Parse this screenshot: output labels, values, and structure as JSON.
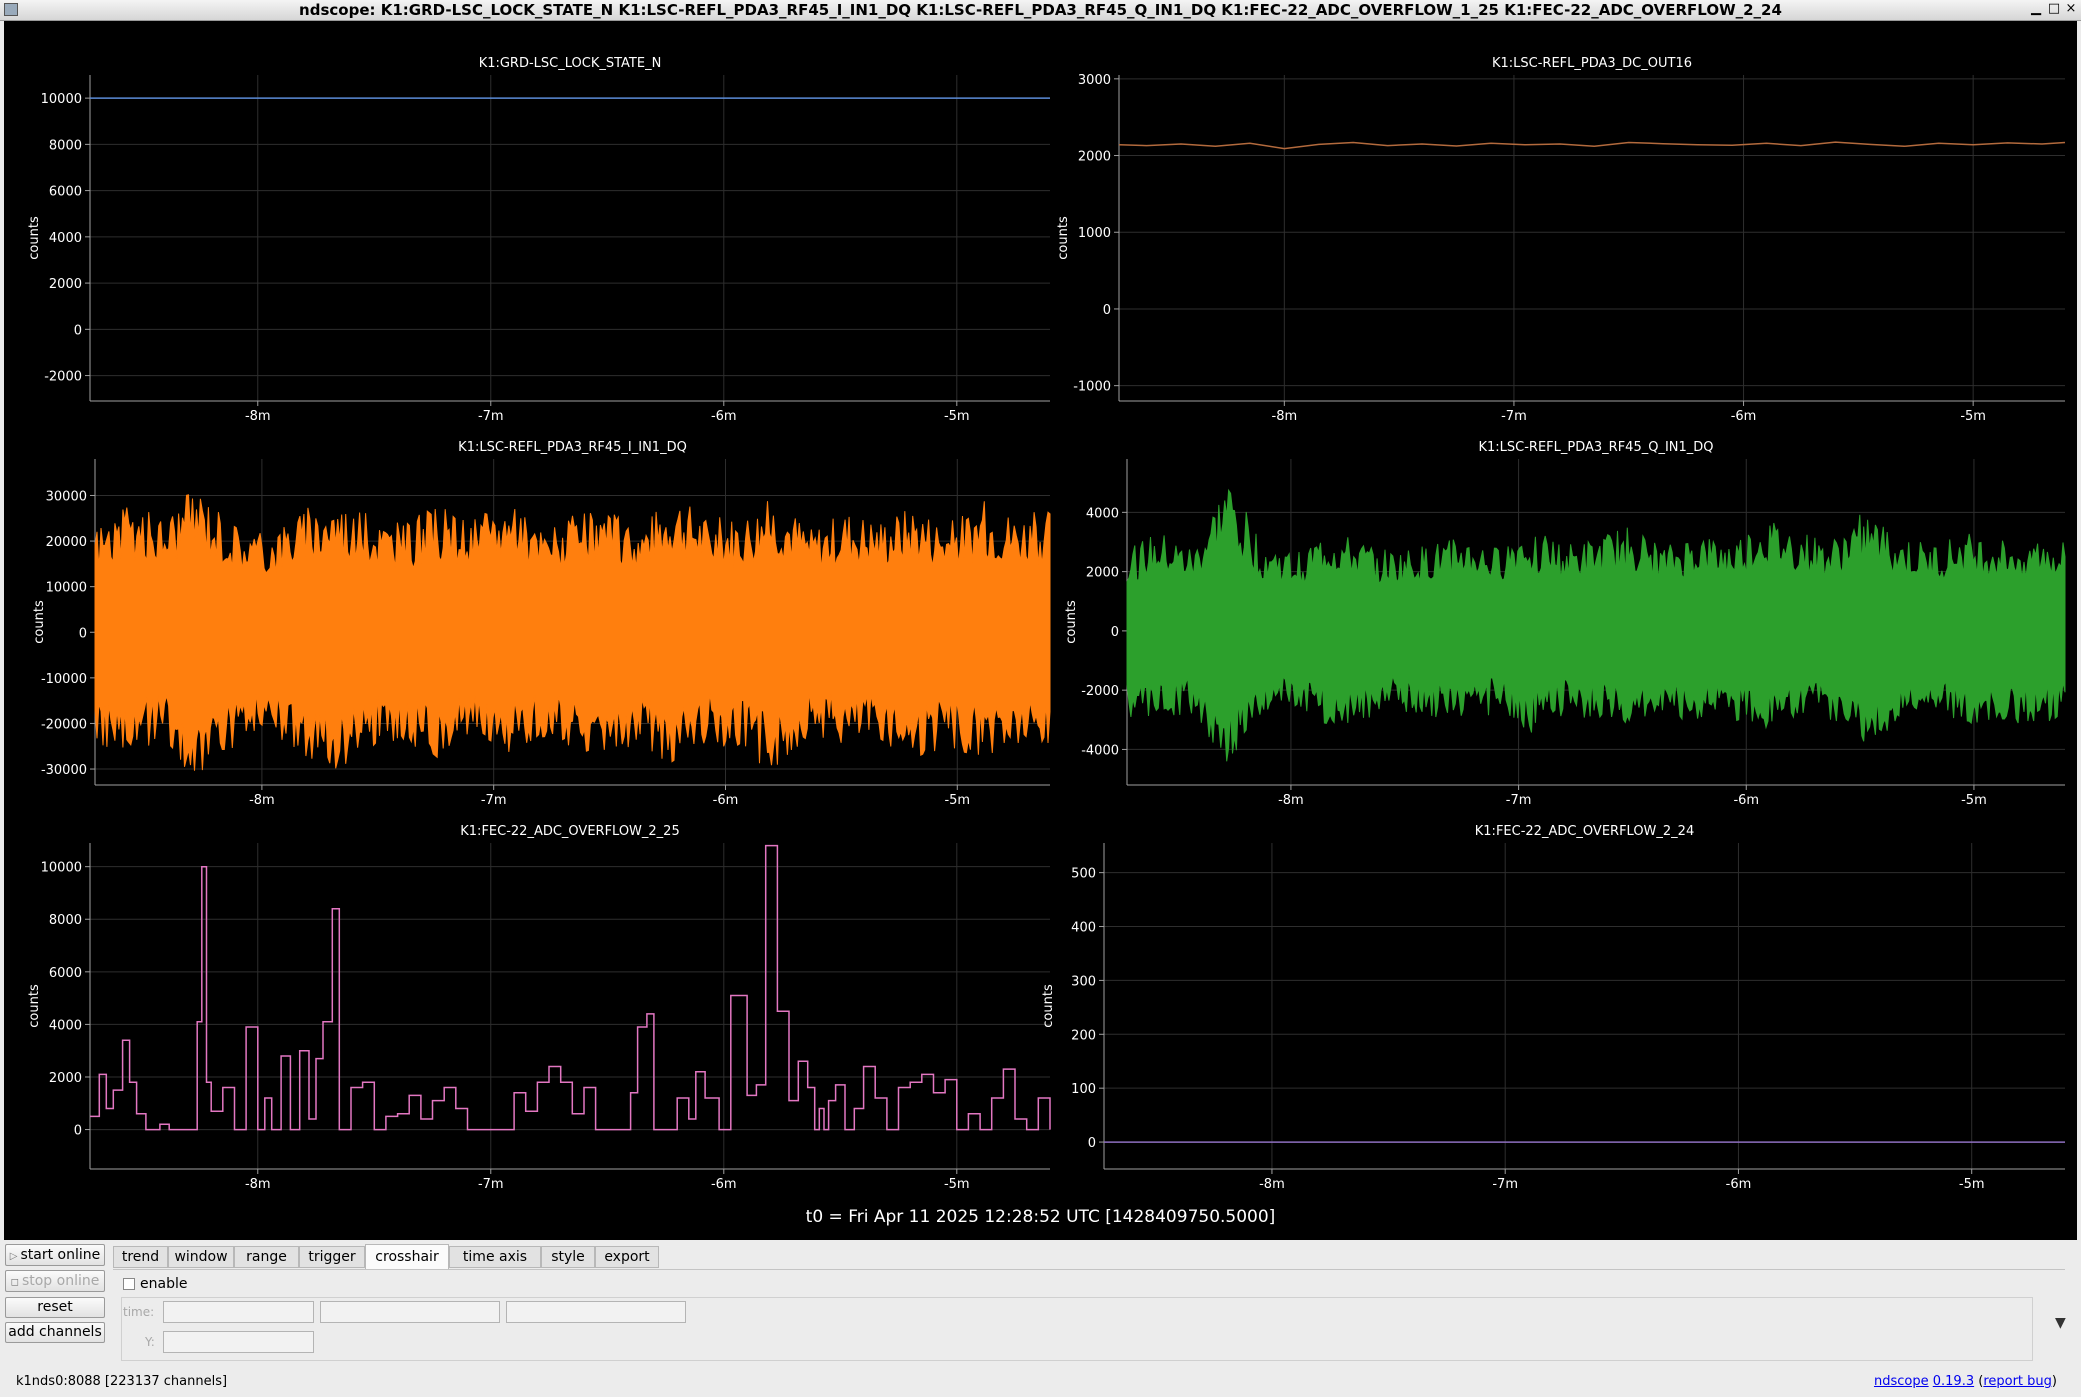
{
  "window": {
    "title": "ndscope: K1:GRD-LSC_LOCK_STATE_N K1:LSC-REFL_PDA3_RF45_I_IN1_DQ K1:LSC-REFL_PDA3_RF45_Q_IN1_DQ K1:FEC-22_ADC_OVERFLOW_1_25 K1:FEC-22_ADC_OVERFLOW_2_24",
    "minimize": "▁",
    "maximize": "□",
    "close": "×"
  },
  "colors": {
    "background": "#000000",
    "grid": "#2e2e2e",
    "axis": "#a0a0a0",
    "trace_blue": "#5b8bd6",
    "trace_brown": "#b36a3d",
    "trace_orange": "#ff7f0e",
    "trace_green": "#2ca02c",
    "trace_pink": "#e377c2",
    "trace_purple": "#8e6fbf"
  },
  "chart_data": [
    {
      "type": "line",
      "title": "K1:GRD-LSC_LOCK_STATE_N",
      "ylabel": "counts",
      "xlim": [
        -8.72,
        -4.6
      ],
      "ylim": [
        -3100,
        11000
      ],
      "yticks": [
        -2000,
        0,
        2000,
        4000,
        6000,
        8000,
        10000
      ],
      "xticks": [
        -8,
        -7,
        -6,
        -5
      ],
      "xticklabels": [
        "-8m",
        "-7m",
        "-6m",
        "-5m"
      ],
      "x_unit": "min",
      "series": [
        {
          "color": "#5b8bd6",
          "x": [
            -8.72,
            -4.6
          ],
          "y": [
            10000,
            10000
          ]
        }
      ]
    },
    {
      "type": "line",
      "title": "K1:LSC-REFL_PDA3_DC_OUT16",
      "ylabel": "counts",
      "xlim": [
        -8.72,
        -4.6
      ],
      "ylim": [
        -1200,
        3050
      ],
      "yticks": [
        -1000,
        0,
        1000,
        2000,
        3000
      ],
      "xticks": [
        -8,
        -7,
        -6,
        -5
      ],
      "xticklabels": [
        "-8m",
        "-7m",
        "-6m",
        "-5m"
      ],
      "x_unit": "min",
      "series": [
        {
          "color": "#b36a3d",
          "x": [
            -8.72,
            -8.6,
            -8.45,
            -8.3,
            -8.15,
            -8.0,
            -7.85,
            -7.7,
            -7.55,
            -7.4,
            -7.25,
            -7.1,
            -6.95,
            -6.8,
            -6.65,
            -6.5,
            -6.35,
            -6.2,
            -6.05,
            -5.9,
            -5.75,
            -5.6,
            -5.45,
            -5.3,
            -5.15,
            -5.0,
            -4.85,
            -4.7,
            -4.6
          ],
          "y": [
            2140,
            2130,
            2150,
            2120,
            2160,
            2090,
            2145,
            2170,
            2130,
            2150,
            2125,
            2160,
            2140,
            2150,
            2120,
            2170,
            2155,
            2140,
            2135,
            2160,
            2130,
            2175,
            2145,
            2120,
            2160,
            2140,
            2165,
            2150,
            2170
          ]
        }
      ]
    },
    {
      "type": "line",
      "title": "K1:LSC-REFL_PDA3_RF45_I_IN1_DQ",
      "ylabel": "counts",
      "xlim": [
        -8.72,
        -4.6
      ],
      "ylim": [
        -33500,
        38000
      ],
      "yticks": [
        -30000,
        -20000,
        -10000,
        0,
        10000,
        20000,
        30000
      ],
      "xticks": [
        -8,
        -7,
        -6,
        -5
      ],
      "xticklabels": [
        "-8m",
        "-7m",
        "-6m",
        "-5m"
      ],
      "x_unit": "min",
      "render": "envelope",
      "series": [
        {
          "color": "#ff7f0e",
          "x": [
            -8.72,
            -8.6,
            -8.45,
            -8.3,
            -8.15,
            -8.0,
            -7.85,
            -7.7,
            -7.55,
            -7.4,
            -7.25,
            -7.1,
            -6.95,
            -6.8,
            -6.65,
            -6.5,
            -6.35,
            -6.2,
            -6.05,
            -5.9,
            -5.75,
            -5.6,
            -5.45,
            -5.3,
            -5.15,
            -5.0,
            -4.85,
            -4.7,
            -4.6
          ],
          "y_max": [
            24000,
            28000,
            26000,
            33000,
            25000,
            22000,
            27000,
            30000,
            26000,
            24000,
            28000,
            25000,
            29000,
            23000,
            26000,
            27000,
            24000,
            31000,
            25000,
            26000,
            30000,
            23000,
            27000,
            25000,
            28000,
            24000,
            29000,
            26000,
            27000
          ],
          "y_min": [
            -25000,
            -27000,
            -24000,
            -33000,
            -26000,
            -22000,
            -28000,
            -31000,
            -25000,
            -24000,
            -29000,
            -24000,
            -28000,
            -23000,
            -27000,
            -26000,
            -25000,
            -30000,
            -24000,
            -27000,
            -31000,
            -22000,
            -26000,
            -24000,
            -29000,
            -25000,
            -28000,
            -26000,
            -27000
          ]
        }
      ]
    },
    {
      "type": "line",
      "title": "K1:LSC-REFL_PDA3_RF45_Q_IN1_DQ",
      "ylabel": "counts",
      "xlim": [
        -8.72,
        -4.6
      ],
      "ylim": [
        -5200,
        5800
      ],
      "yticks": [
        -4000,
        -2000,
        0,
        2000,
        4000
      ],
      "xticks": [
        -8,
        -7,
        -6,
        -5
      ],
      "xticklabels": [
        "-8m",
        "-7m",
        "-6m",
        "-5m"
      ],
      "x_unit": "min",
      "render": "envelope",
      "series": [
        {
          "color": "#2ca02c",
          "x": [
            -8.72,
            -8.6,
            -8.45,
            -8.3,
            -8.15,
            -8.0,
            -7.85,
            -7.7,
            -7.55,
            -7.4,
            -7.25,
            -7.1,
            -6.95,
            -6.8,
            -6.65,
            -6.5,
            -6.35,
            -6.2,
            -6.05,
            -5.9,
            -5.75,
            -5.6,
            -5.45,
            -5.3,
            -5.15,
            -5.0,
            -4.85,
            -4.7,
            -4.6
          ],
          "y_max": [
            2900,
            3300,
            2800,
            5200,
            3100,
            2600,
            3400,
            3000,
            2700,
            2900,
            3200,
            2800,
            3700,
            2900,
            3100,
            3600,
            2800,
            3300,
            3000,
            3800,
            3400,
            3000,
            4100,
            3200,
            2900,
            3300,
            3100,
            3200,
            3000
          ],
          "y_min": [
            -2900,
            -3200,
            -2800,
            -4600,
            -3000,
            -2600,
            -3300,
            -3100,
            -2700,
            -2900,
            -3100,
            -2800,
            -3500,
            -2900,
            -3000,
            -3500,
            -2800,
            -3200,
            -3000,
            -3500,
            -3300,
            -3000,
            -4100,
            -3100,
            -2900,
            -3200,
            -3000,
            -3200,
            -3000
          ]
        }
      ]
    },
    {
      "type": "line",
      "title": "K1:FEC-22_ADC_OVERFLOW_2_25",
      "ylabel": "counts",
      "xlim": [
        -8.72,
        -4.6
      ],
      "ylim": [
        -1500,
        10900
      ],
      "yticks": [
        0,
        2000,
        4000,
        6000,
        8000,
        10000
      ],
      "xticks": [
        -8,
        -7,
        -6,
        -5
      ],
      "xticklabels": [
        "-8m",
        "-7m",
        "-6m",
        "-5m"
      ],
      "x_unit": "min",
      "render": "step",
      "series": [
        {
          "color": "#e377c2",
          "x": [
            -8.72,
            -8.68,
            -8.65,
            -8.62,
            -8.58,
            -8.55,
            -8.52,
            -8.48,
            -8.45,
            -8.42,
            -8.38,
            -8.3,
            -8.26,
            -8.24,
            -8.22,
            -8.2,
            -8.15,
            -8.1,
            -8.05,
            -8.0,
            -7.97,
            -7.94,
            -7.9,
            -7.86,
            -7.82,
            -7.78,
            -7.75,
            -7.72,
            -7.68,
            -7.65,
            -7.63,
            -7.6,
            -7.55,
            -7.5,
            -7.45,
            -7.4,
            -7.35,
            -7.3,
            -7.25,
            -7.2,
            -7.15,
            -7.1,
            -7.0,
            -6.9,
            -6.85,
            -6.8,
            -6.75,
            -6.7,
            -6.65,
            -6.6,
            -6.55,
            -6.45,
            -6.4,
            -6.37,
            -6.33,
            -6.3,
            -6.25,
            -6.2,
            -6.15,
            -6.12,
            -6.08,
            -6.02,
            -5.97,
            -5.9,
            -5.86,
            -5.82,
            -5.77,
            -5.72,
            -5.68,
            -5.64,
            -5.61,
            -5.59,
            -5.57,
            -5.55,
            -5.52,
            -5.48,
            -5.44,
            -5.4,
            -5.35,
            -5.3,
            -5.25,
            -5.2,
            -5.15,
            -5.1,
            -5.05,
            -5.0,
            -4.95,
            -4.9,
            -4.85,
            -4.8,
            -4.75,
            -4.7,
            -4.65,
            -4.6
          ],
          "y": [
            500,
            2100,
            800,
            1500,
            3400,
            1800,
            600,
            0,
            0,
            200,
            0,
            0,
            4100,
            10000,
            1800,
            700,
            1600,
            0,
            3900,
            0,
            1200,
            0,
            2800,
            0,
            3000,
            400,
            2700,
            4100,
            8400,
            0,
            0,
            1600,
            1800,
            0,
            500,
            600,
            1300,
            400,
            1100,
            1600,
            800,
            0,
            0,
            1400,
            700,
            1800,
            2400,
            1800,
            600,
            1600,
            0,
            0,
            1400,
            3900,
            4400,
            0,
            0,
            1200,
            400,
            2200,
            1200,
            0,
            5100,
            1300,
            1700,
            10800,
            4500,
            1100,
            2600,
            1600,
            0,
            800,
            0,
            1100,
            1700,
            0,
            800,
            2400,
            1200,
            0,
            1600,
            1800,
            2100,
            1400,
            1900,
            0,
            600,
            0,
            1200,
            2300,
            400,
            0,
            1200,
            0
          ]
        }
      ]
    },
    {
      "type": "line",
      "title": "K1:FEC-22_ADC_OVERFLOW_2_24",
      "ylabel": "counts",
      "xlim": [
        -8.72,
        -4.6
      ],
      "ylim": [
        -50,
        555
      ],
      "yticks": [
        0,
        100,
        200,
        300,
        400,
        500
      ],
      "xticks": [
        -8,
        -7,
        -6,
        -5
      ],
      "xticklabels": [
        "-8m",
        "-7m",
        "-6m",
        "-5m"
      ],
      "x_unit": "min",
      "series": [
        {
          "color": "#8e6fbf",
          "x": [
            -8.72,
            -4.6
          ],
          "y": [
            0,
            0
          ]
        }
      ]
    }
  ],
  "t0_label": "t0 = Fri Apr 11 2025 12:28:52 UTC [1428409750.5000]",
  "controls": {
    "start_online": "start online",
    "stop_online": "stop online",
    "reset": "reset",
    "add_channels": "add channels",
    "tabs": [
      "trend",
      "window",
      "range",
      "trigger",
      "crosshair",
      "time axis",
      "style",
      "export"
    ],
    "active_tab": "crosshair",
    "crosshair": {
      "enable_label": "enable",
      "enabled": false,
      "time_label": "time:",
      "y_label": "Y:",
      "time_value": "",
      "time_value_2": "",
      "time_value_3": "",
      "y_value": ""
    },
    "dropdown_arrow": "▼"
  },
  "status": {
    "server": "k1nds0:8088  [223137 channels]",
    "app_name": "ndscope",
    "version": "0.19.3",
    "paren_open": "(",
    "report_bug": "report bug",
    "paren_close": ")"
  }
}
